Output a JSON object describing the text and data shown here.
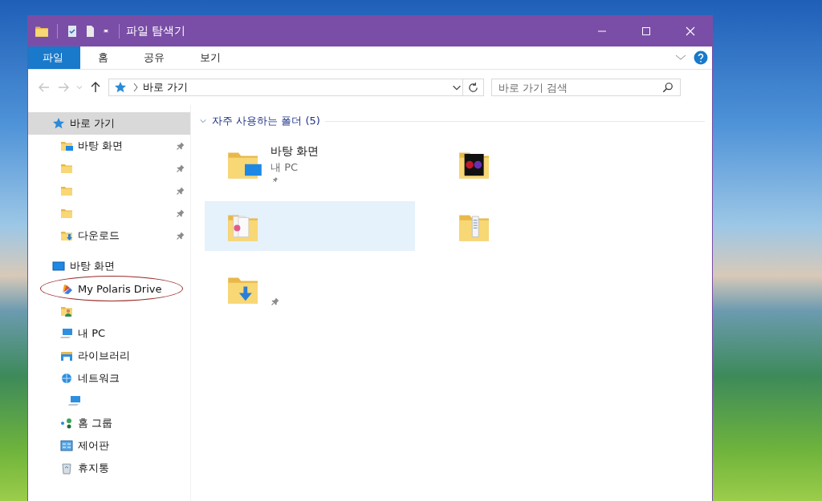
{
  "window": {
    "title": "파일 탐색기"
  },
  "ribbon_tabs": [
    {
      "label": "파일",
      "kind": "file"
    },
    {
      "label": "홈",
      "kind": "tab"
    },
    {
      "label": "공유",
      "kind": "tab"
    },
    {
      "label": "보기",
      "kind": "tab"
    }
  ],
  "address_bar": {
    "nav_buttons": [
      {
        "kind": "back",
        "disabled": true
      },
      {
        "kind": "forward",
        "disabled": true
      },
      {
        "kind": "recent",
        "disabled": true
      },
      {
        "kind": "up",
        "disabled": false
      }
    ],
    "path": "바로 가기",
    "search": {
      "placeholder": "바로 가기 검색"
    }
  },
  "nav_pane": {
    "items": [
      {
        "label": "바로 가기",
        "kind": "star",
        "selected": true,
        "children": [
          {
            "label": "바탕 화면",
            "kind": "desktop-folder",
            "pinned": true,
            "selected": false
          },
          {
            "kind": "folder",
            "pinned": true,
            "selected": false
          },
          {
            "kind": "folder",
            "pinned": true,
            "selected": false
          },
          {
            "kind": "folder",
            "pinned": true,
            "selected": false
          },
          {
            "label": "다운로드",
            "kind": "download",
            "pinned": true,
            "selected": false
          }
        ]
      },
      {
        "label": "바탕 화면",
        "kind": "desktop",
        "selected": false,
        "children": [
          {
            "label": "My Polaris Drive",
            "kind": "polaris",
            "circled": true,
            "selected": false
          },
          {
            "kind": "user",
            "circled": false,
            "selected": false
          },
          {
            "label": "내 PC",
            "kind": "pc",
            "circled": false,
            "selected": false
          },
          {
            "label": "라이브러리",
            "kind": "library",
            "circled": false,
            "selected": false
          },
          {
            "label": "네트워크",
            "kind": "network",
            "circled": false,
            "selected": false,
            "children": [
              {
                "kind": "computer",
                "selected": false
              }
            ]
          },
          {
            "label": "홈 그룹",
            "kind": "homegroup",
            "circled": false,
            "selected": false
          },
          {
            "label": "제어판",
            "kind": "control",
            "circled": false,
            "selected": false
          },
          {
            "label": "휴지통",
            "kind": "recycle",
            "circled": false,
            "selected": false
          }
        ]
      }
    ]
  },
  "content": {
    "section": {
      "title": "자주 사용하는 폴더 (5)",
      "expanded": true
    },
    "tiles": [
      {
        "name": "바탕 화면",
        "location": "내 PC",
        "kind": "desktop",
        "pinned": true,
        "selected": false
      },
      {
        "kind": "media",
        "pinned": false,
        "selected": false
      },
      {
        "kind": "music",
        "pinned": false,
        "selected": true
      },
      {
        "kind": "documents",
        "pinned": false,
        "selected": false
      },
      {
        "kind": "download",
        "pinned": true,
        "selected": false
      }
    ]
  }
}
